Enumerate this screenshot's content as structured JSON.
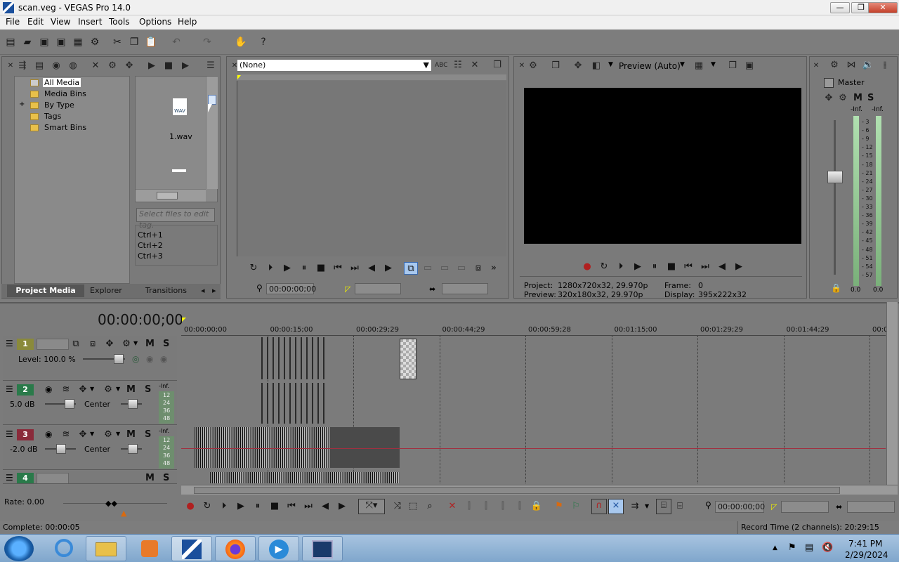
{
  "window": {
    "title": "scan.veg - VEGAS Pro 14.0",
    "min": "—",
    "max": "❐",
    "close": "✕"
  },
  "menu": [
    "File",
    "Edit",
    "View",
    "Insert",
    "Tools",
    "Options",
    "Help"
  ],
  "media": {
    "tree": [
      "All Media",
      "Media Bins",
      "By Type",
      "Tags",
      "Smart Bins"
    ],
    "file": "1.wav",
    "file_badge": "WAV",
    "tag_placeholder": "Select files to edit tag.",
    "shortcuts": [
      "Ctrl+1",
      "Ctrl+2",
      "Ctrl+3"
    ],
    "tabs": [
      "Project Media",
      "Explorer",
      "Transitions"
    ]
  },
  "trimmer": {
    "dropdown": "(None)",
    "timecode": "00:00:00;00"
  },
  "preview": {
    "mode": "Preview (Auto)",
    "project_label": "Project:",
    "project": "1280x720x32, 29.970p",
    "preview_label": "Preview:",
    "preview": "320x180x32, 29.970p",
    "frame_label": "Frame:",
    "frame": "0",
    "display_label": "Display:",
    "display": "395x222x32"
  },
  "master": {
    "label": "Master",
    "left": "-Inf.",
    "right": "-Inf.",
    "scale": [
      "3",
      "6",
      "9",
      "12",
      "15",
      "18",
      "21",
      "24",
      "27",
      "30",
      "33",
      "36",
      "39",
      "42",
      "45",
      "48",
      "51",
      "54",
      "57"
    ],
    "val_l": "0.0",
    "val_r": "0.0"
  },
  "timeline": {
    "timecode": "00:00:00;00",
    "ruler": [
      "00:00:00;00",
      "00:00:15;00",
      "00:00:29;29",
      "00:00:44;29",
      "00:00:59;28",
      "00:01:15;00",
      "00:01:29;29",
      "00:01:44;29",
      "00:0"
    ],
    "tracks": [
      {
        "num": "1",
        "color": "#8a8a3a",
        "level": "Level: 100.0 %"
      },
      {
        "num": "2",
        "color": "#2a7a4a",
        "vol": "5.0 dB",
        "pan": "Center"
      },
      {
        "num": "3",
        "color": "#8a2a3a",
        "vol": "-2.0 dB",
        "pan": "Center"
      },
      {
        "num": "4",
        "color": "#2a7a4a"
      }
    ],
    "meter_label": "-Inf.",
    "meter_scale": [
      "12",
      "24",
      "36",
      "48"
    ],
    "rate": "Rate: 0.00",
    "cursor_time": "00:00:00;00"
  },
  "status": {
    "left": "Complete: 00:00:05",
    "right": "Record Time (2 channels): 20:29:15"
  },
  "taskbar": {
    "time": "7:41 PM",
    "date": "2/29/2024"
  },
  "colors": {
    "track1": "#8a8a3a",
    "track2": "#2a7a4a",
    "track3": "#8a2a3a",
    "track4": "#2a7a4a",
    "taskbar": "#8fb2d6"
  }
}
